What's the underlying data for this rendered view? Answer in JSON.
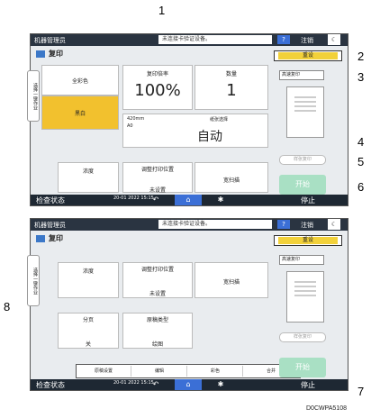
{
  "callouts": [
    "1",
    "2",
    "3",
    "4",
    "5",
    "6",
    "7",
    "8"
  ],
  "screen": {
    "user": "机器管理员",
    "status": "未连接卡验证设备。",
    "help": "?",
    "logout": "注销",
    "moon": "☾",
    "app_title": "复印",
    "reset": "重设",
    "sidetab": "选择一键作业",
    "color_full": "全彩色",
    "color_bw": "黑白",
    "ratio_label": "复印倍率",
    "ratio_value": "100%",
    "qty_label": "数量",
    "qty_value": "1",
    "paper_size": "420mm",
    "paper_a0": "A0",
    "tray_label": "纸张选择",
    "auto": "自动",
    "density": "浓度",
    "adjust_label": "调整打印位置",
    "not_set": "未设置",
    "duplex": "宽扫描",
    "high_speed": "高速复印",
    "sample_copy": "样张复印",
    "start": "开始",
    "check_status": "检查状态",
    "datetime": "20-01 2022 15:15",
    "stop": "停止",
    "sort_label": "分页",
    "sort_value": "关",
    "orig_type_label": "原稿类型",
    "orig_type_value": "绘图",
    "tabs": [
      "原稿设置",
      "编辑",
      "彩色",
      "合并"
    ]
  },
  "figure_id": "D0CWPA5108"
}
